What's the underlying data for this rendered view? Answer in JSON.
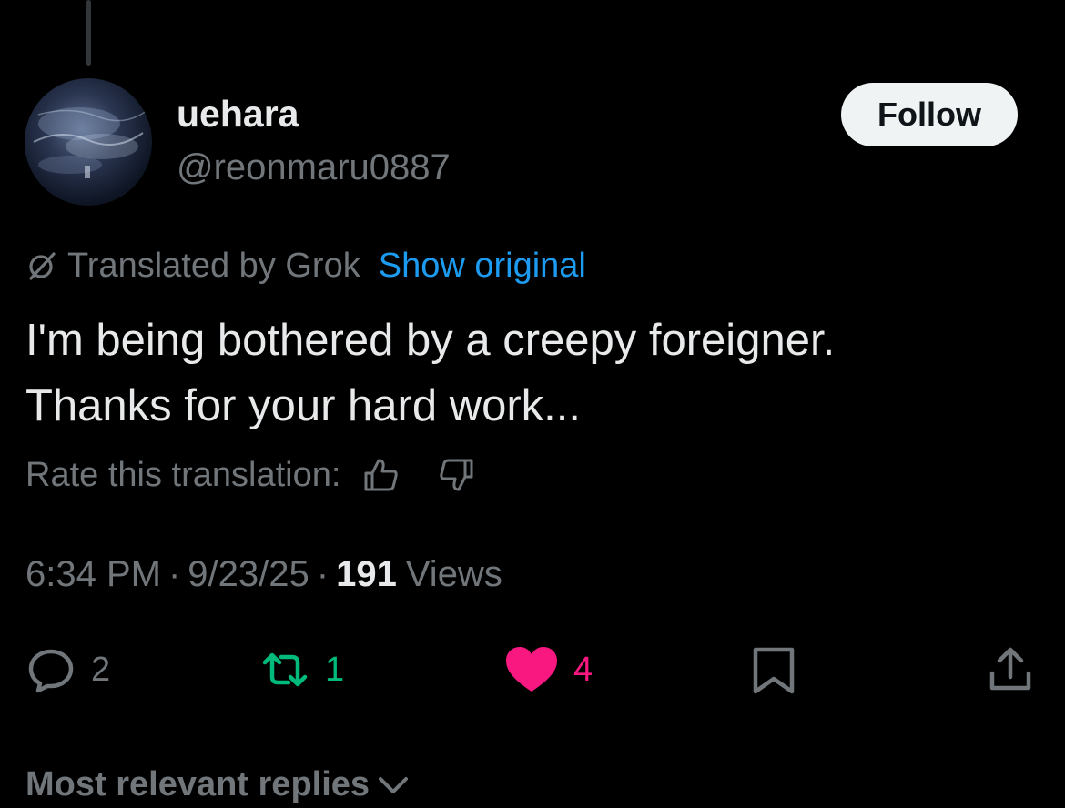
{
  "post": {
    "author": {
      "display_name": "uehara",
      "handle": "@reonmaru0887"
    },
    "follow_label": "Follow",
    "translation": {
      "translated_by": "Translated by Grok",
      "show_original": "Show original"
    },
    "text_lines": [
      "I'm being bothered by a creepy foreigner.",
      "Thanks for your hard work..."
    ],
    "rate_label": "Rate this translation:",
    "meta": {
      "time": "6:34 PM",
      "separator": "·",
      "date": "9/23/25",
      "views_count": "191",
      "views_label": "Views"
    },
    "actions": {
      "replies": "2",
      "reposts": "1",
      "likes": "4"
    },
    "replies_sort_label": "Most relevant replies"
  },
  "colors": {
    "background": "#000000",
    "text_primary": "#e7e9ea",
    "text_secondary": "#71767b",
    "link": "#1d9bf0",
    "repost_active": "#00ba7c",
    "like_active": "#f91880",
    "follow_bg": "#eff3f4"
  },
  "icons": {
    "translation": "grok-slash-icon",
    "thumbs_up": "thumbs-up-icon",
    "thumbs_down": "thumbs-down-icon",
    "reply": "reply-bubble-icon",
    "repost": "repost-icon",
    "like": "heart-filled-icon",
    "bookmark": "bookmark-icon",
    "share": "share-icon",
    "sort": "chevron-down-icon"
  }
}
